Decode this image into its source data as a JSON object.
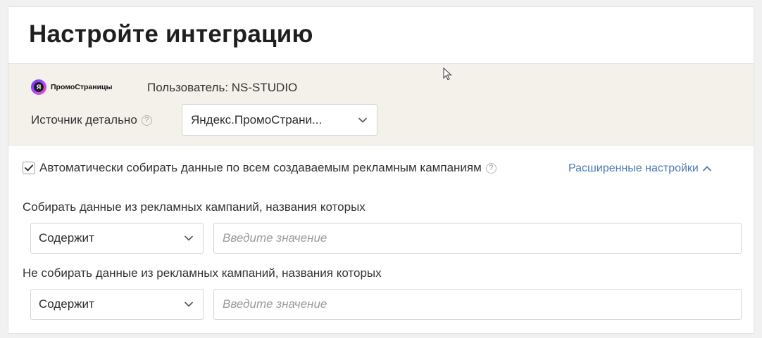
{
  "page": {
    "title": "Настройте интеграцию"
  },
  "source": {
    "logo_text": "ПромоСтраницы",
    "logo_letter": "Я",
    "user": "Пользователь: NS-STUDIO",
    "detail_label": "Источник детально",
    "help_glyph": "?",
    "selected": "Яндекс.ПромоСтрани..."
  },
  "settings": {
    "auto_collect_label": "Автоматически собирать данные по всем создаваемым рекламным кампаниям",
    "auto_collect_checked": true,
    "help_glyph": "?",
    "advanced_link": "Расширенные настройки",
    "include": {
      "label": "Собирать данные из рекламных кампаний, названия которых",
      "condition": "Содержит",
      "placeholder": "Введите значение"
    },
    "exclude": {
      "label": "Не собирать данные из рекламных кампаний, названия которых",
      "condition": "Содержит",
      "placeholder": "Введите значение"
    }
  },
  "icons": {
    "help": "help-circle-icon",
    "chevron": "chevron-down-icon",
    "chevron_up": "chevron-up-icon",
    "check": "check-icon",
    "cursor": "mouse-pointer-icon"
  },
  "colors": {
    "source_block_bg": "#f3f1ea",
    "link": "#4a7ab3",
    "placeholder": "#9a9a9a"
  }
}
